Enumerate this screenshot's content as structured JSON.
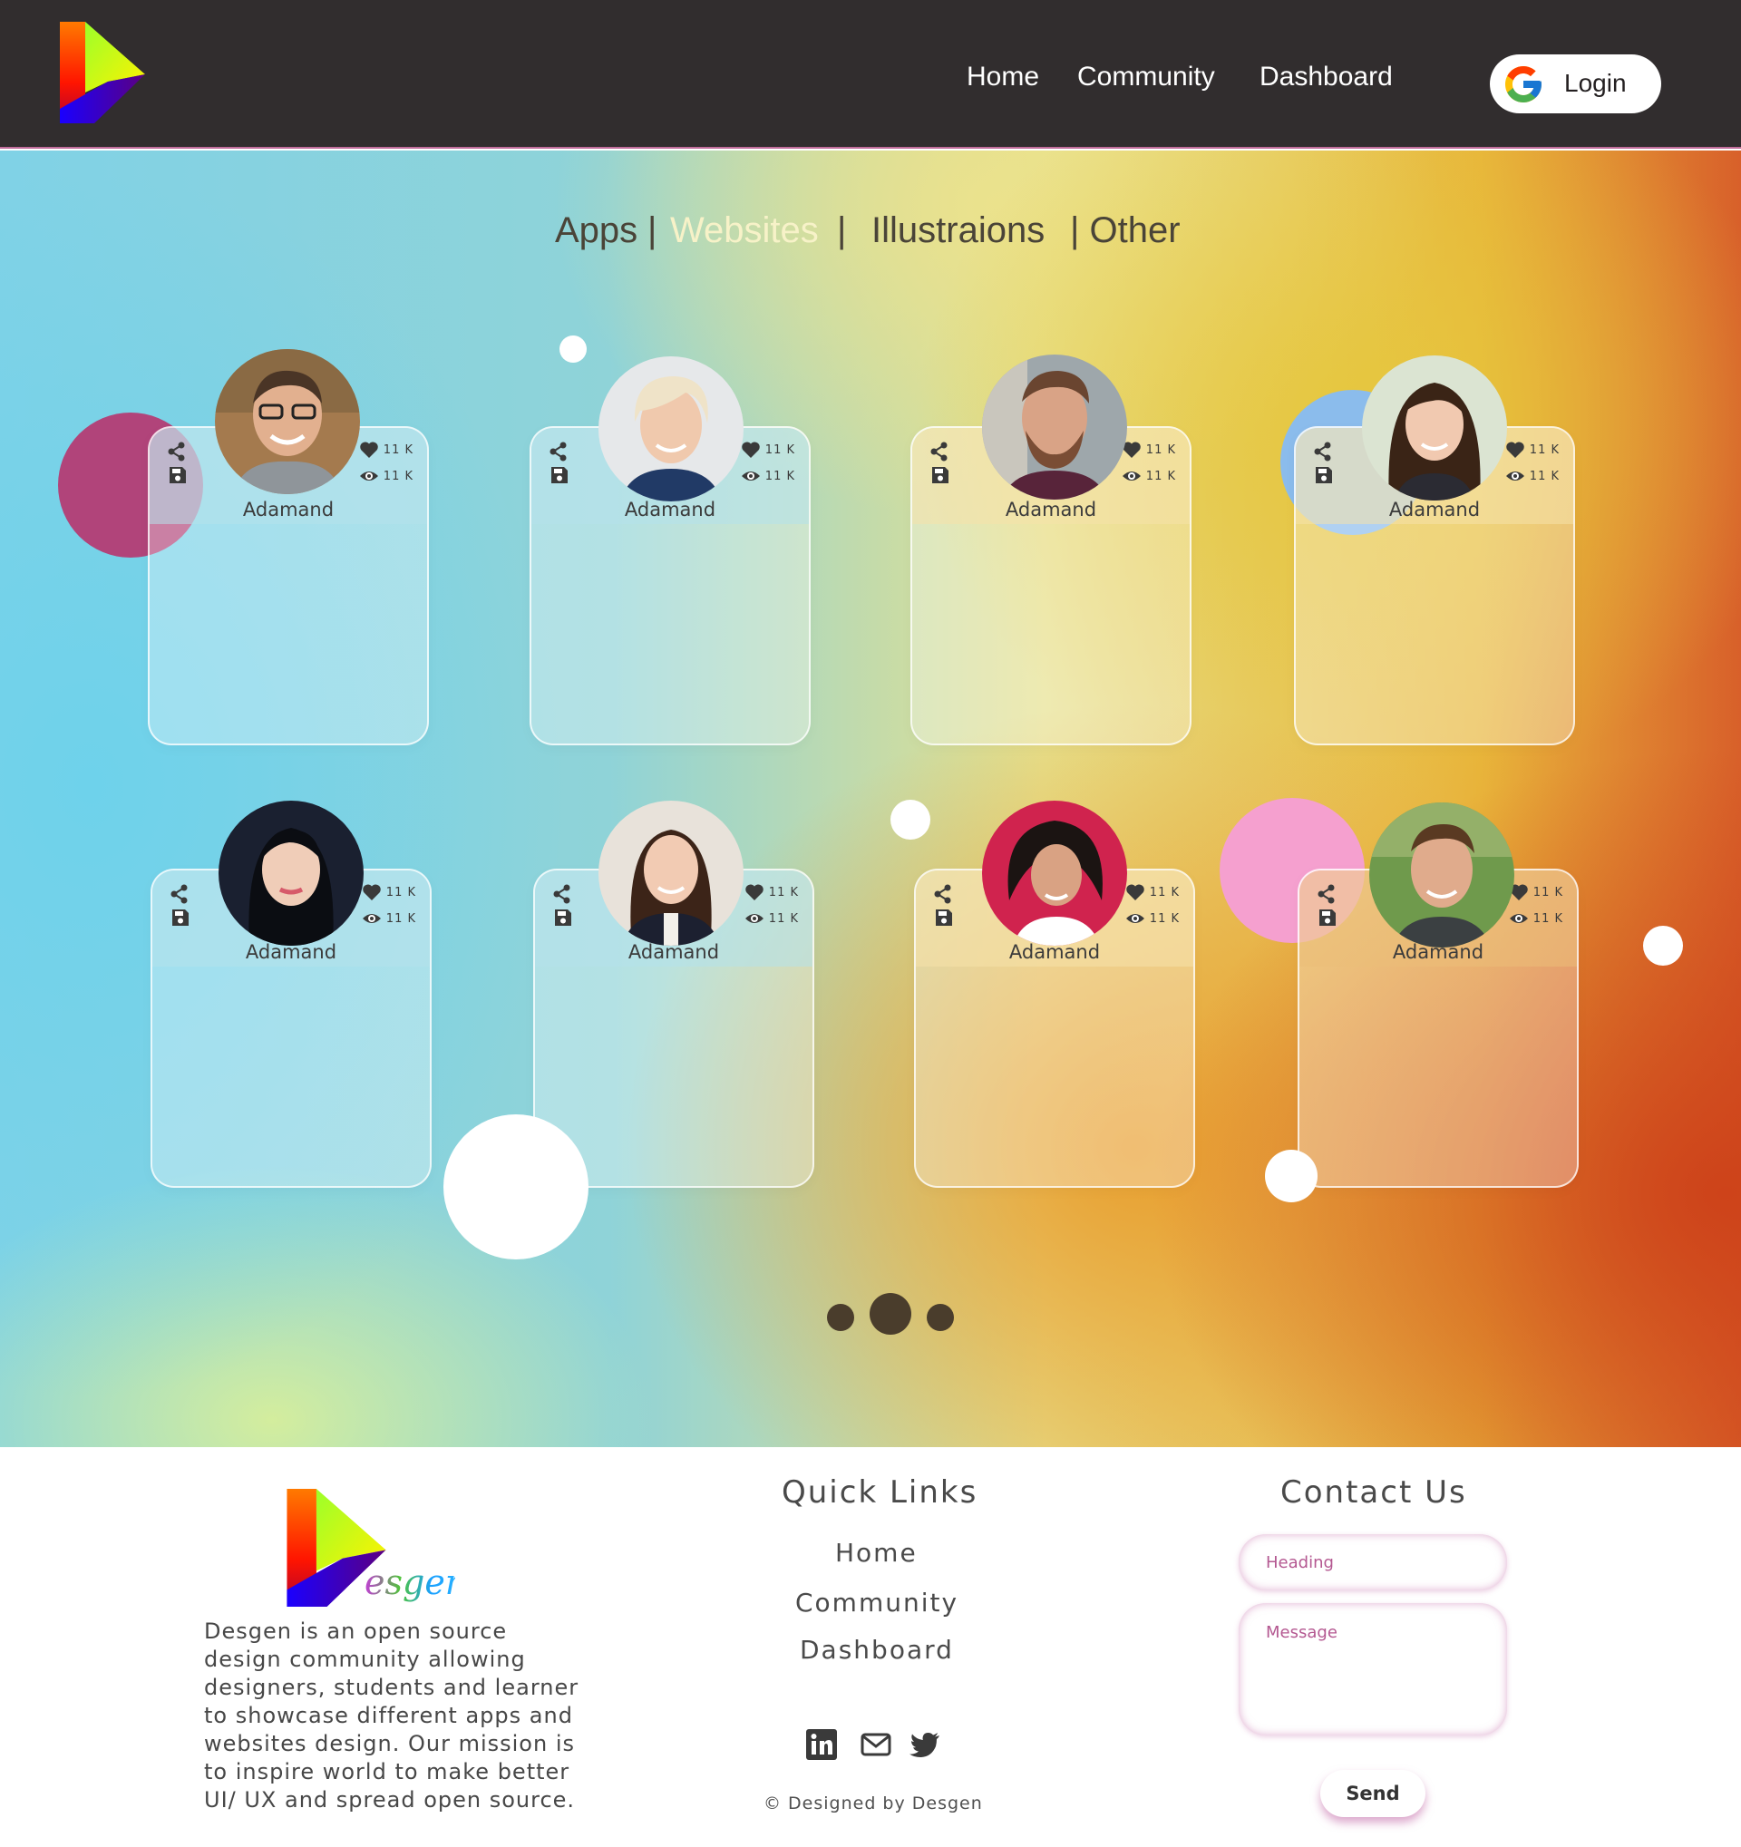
{
  "header": {
    "nav": [
      {
        "label": "Home"
      },
      {
        "label": "Community"
      },
      {
        "label": "Dashboard"
      }
    ],
    "login_label": "Login"
  },
  "filters": {
    "items": [
      {
        "label": "Apps",
        "active": false
      },
      {
        "label": "|",
        "active": false
      },
      {
        "label": "Websites",
        "active": true
      },
      {
        "label": "|",
        "active": false
      },
      {
        "label": "Illustraions",
        "active": false
      },
      {
        "label": "| Other",
        "active": false
      }
    ]
  },
  "cards": [
    {
      "name": "Adamand",
      "likes": "11 K",
      "views": "11 K"
    },
    {
      "name": "Adamand",
      "likes": "11 K",
      "views": "11 K"
    },
    {
      "name": "Adamand",
      "likes": "11 K",
      "views": "11 K"
    },
    {
      "name": "Adamand",
      "likes": "11 K",
      "views": "11 K"
    },
    {
      "name": "Adamand",
      "likes": "11 K",
      "views": "11 K"
    },
    {
      "name": "Adamand",
      "likes": "11 K",
      "views": "11 K"
    },
    {
      "name": "Adamand",
      "likes": "11 K",
      "views": "11 K"
    },
    {
      "name": "Adamand",
      "likes": "11 K",
      "views": "11 K"
    }
  ],
  "pagination": {
    "count": 3,
    "active_index": 1
  },
  "footer": {
    "brand": "esgen",
    "about": "Desgen is an open source design community allowing designers, students and learner to showcase different apps and websites design. Our mission is to inspire world to make better UI/ UX and spread open source.",
    "quick_links_title": "Quick Links",
    "quick_links": [
      {
        "label": "Home"
      },
      {
        "label": "Community"
      },
      {
        "label": "Dashboard"
      }
    ],
    "social_icons": [
      "linkedin-icon",
      "mail-icon",
      "twitter-icon"
    ],
    "copyright": "© Designed by Desgen",
    "contact_title": "Contact Us",
    "heading_placeholder": "Heading",
    "message_placeholder": "Message",
    "send_label": "Send"
  }
}
